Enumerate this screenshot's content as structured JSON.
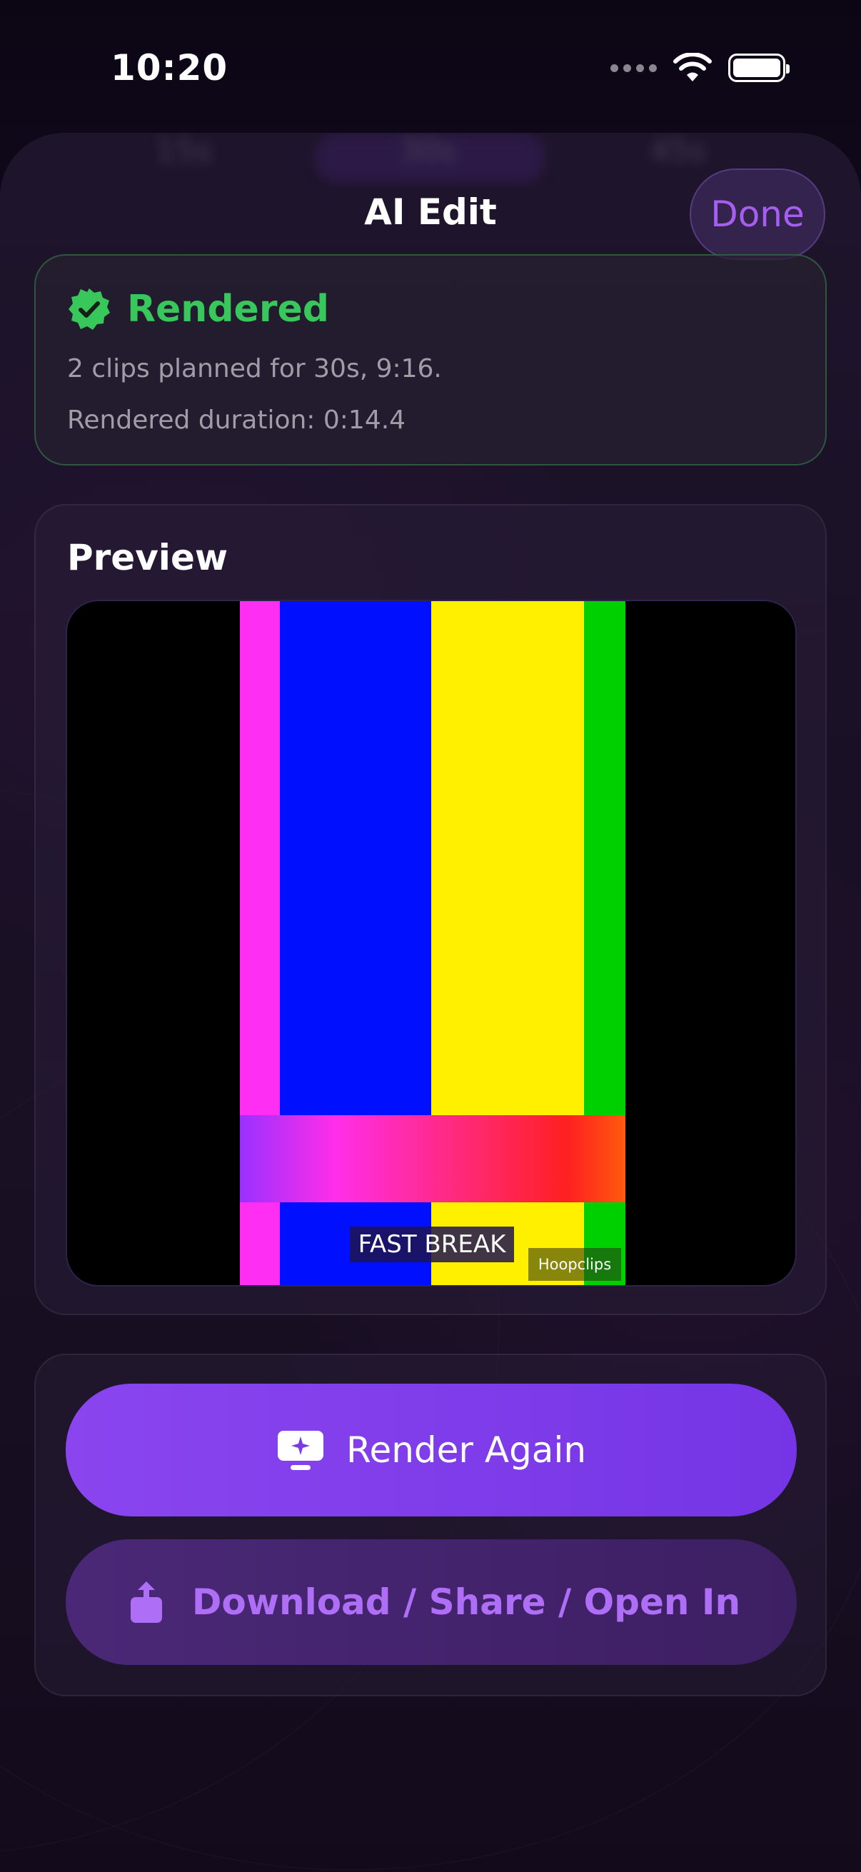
{
  "status_bar": {
    "time": "10:20"
  },
  "behind_tabs": [
    "15s",
    "30s",
    "45s"
  ],
  "nav": {
    "title": "AI Edit",
    "done_label": "Done"
  },
  "render_status": {
    "label": "Rendered",
    "plan_text": "2 clips planned for 30s, 9:16.",
    "duration_text": "Rendered duration: 0:14.4"
  },
  "preview": {
    "title": "Preview",
    "caption": "FAST BREAK",
    "watermark": "Hoopclips",
    "bars": [
      "#ff2ef2",
      "#0010ff",
      "#fff000",
      "#00d000"
    ]
  },
  "actions": {
    "render_again_label": "Render Again",
    "share_label": "Download / Share / Open In"
  },
  "colors": {
    "accent": "#8a45ee",
    "success": "#37c75a",
    "done_text": "#a65ef0",
    "secondary_text": "#ae6ef6"
  }
}
